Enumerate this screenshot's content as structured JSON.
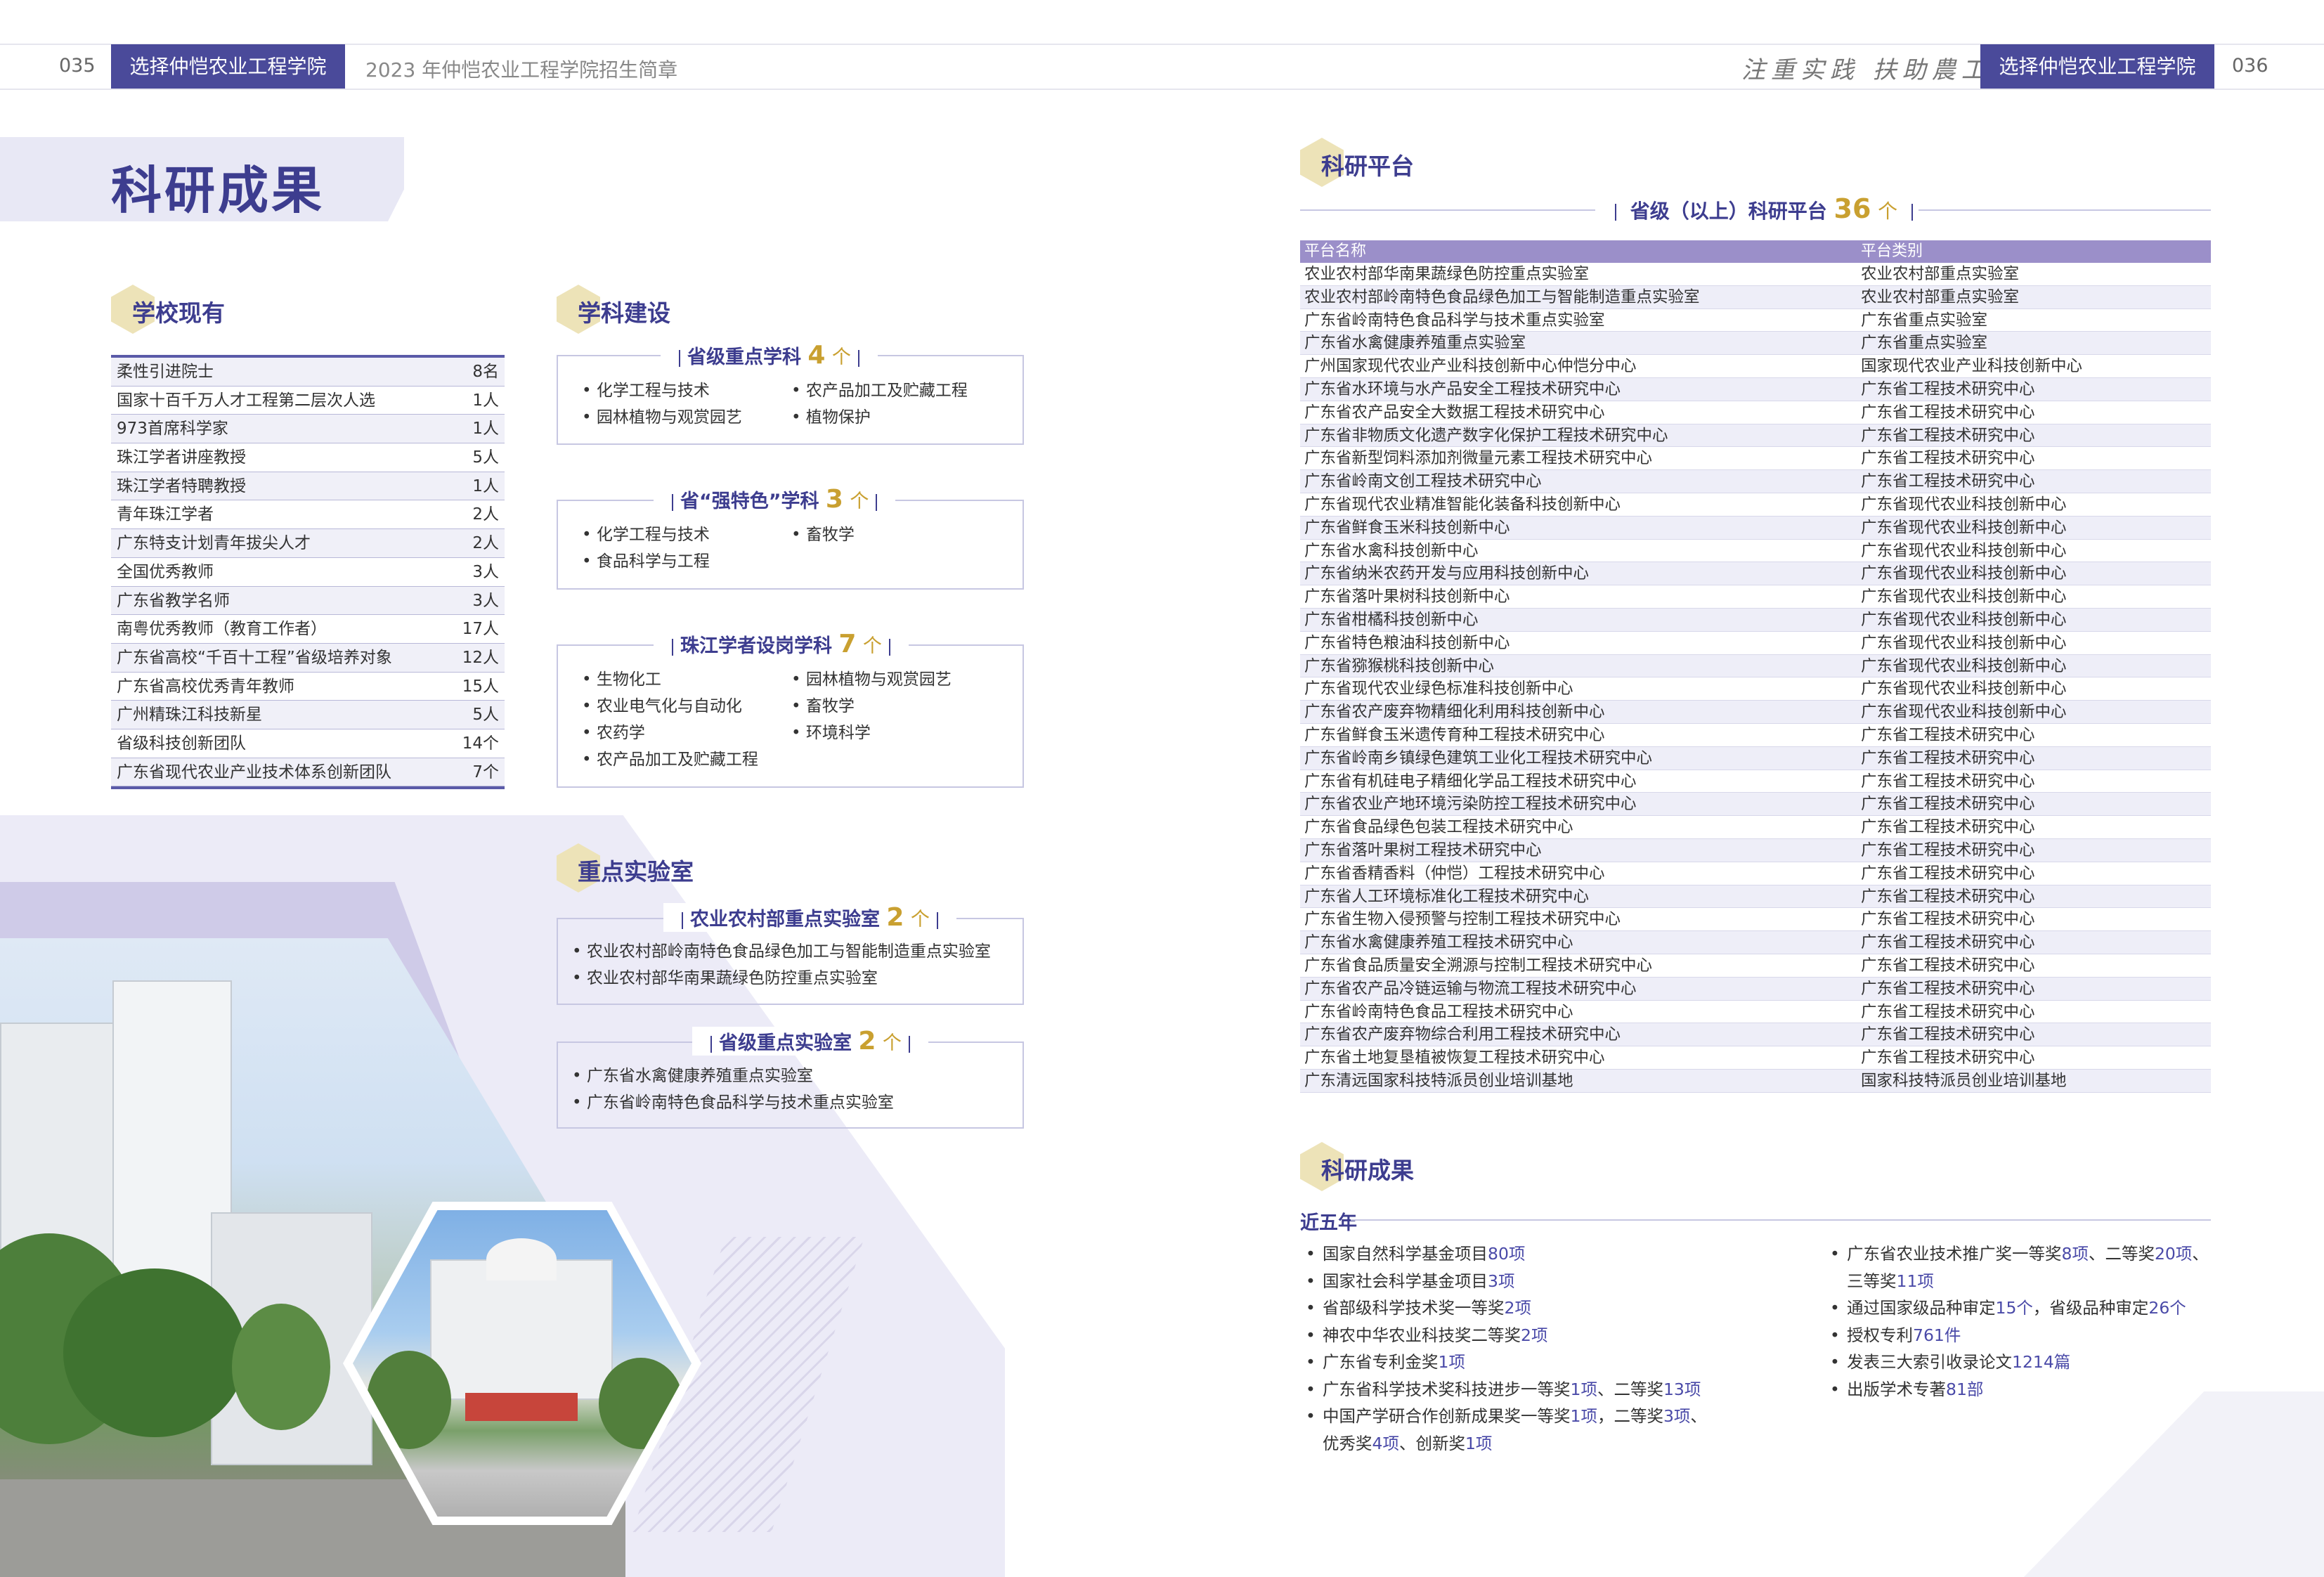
{
  "header": {
    "left_page_num": "035",
    "left_tab": "选择仲恺农业工程学院",
    "brochure_title": "2023 年仲恺农业工程学院招生简章",
    "slogan": "注重实践 扶助農工",
    "right_tab": "选择仲恺农业工程学院",
    "right_page_num": "036"
  },
  "page_title": "科研成果",
  "school": {
    "heading": "学校现有",
    "rows": [
      {
        "name": "柔性引进院士",
        "value": "8名"
      },
      {
        "name": "国家十百千万人才工程第二层次人选",
        "value": "1人"
      },
      {
        "name": "973首席科学家",
        "value": "1人"
      },
      {
        "name": "珠江学者讲座教授",
        "value": "5人"
      },
      {
        "name": "珠江学者特聘教授",
        "value": "1人"
      },
      {
        "name": "青年珠江学者",
        "value": "2人"
      },
      {
        "name": "广东特支计划青年拔尖人才",
        "value": "2人"
      },
      {
        "name": "全国优秀教师",
        "value": "3人"
      },
      {
        "name": "广东省教学名师",
        "value": "3人"
      },
      {
        "name": "南粤优秀教师（教育工作者）",
        "value": "17人"
      },
      {
        "name": "广东省高校“千百十工程”省级培养对象",
        "value": "12人"
      },
      {
        "name": "广东省高校优秀青年教师",
        "value": "15人"
      },
      {
        "name": "广州精珠江科技新星",
        "value": "5人"
      },
      {
        "name": "省级科技创新团队",
        "value": "14个"
      },
      {
        "name": "广东省现代农业产业技术体系创新团队",
        "value": "7个"
      }
    ]
  },
  "discipline": {
    "heading": "学科建设",
    "provincial_key": {
      "label": "省级重点学科",
      "count": "4",
      "unit": "个",
      "left": [
        "化学工程与技术",
        "园林植物与观赏园艺"
      ],
      "right": [
        "农产品加工及贮藏工程",
        "植物保护"
      ]
    },
    "strong": {
      "label": "省“强特色”学科",
      "count": "3",
      "unit": "个",
      "left": [
        "化学工程与技术",
        "食品科学与工程"
      ],
      "right": [
        "畜牧学"
      ]
    },
    "pearl": {
      "label": "珠江学者设岗学科",
      "count": "7",
      "unit": "个",
      "left": [
        "生物化工",
        "农业电气化与自动化",
        "农药学",
        "农产品加工及贮藏工程"
      ],
      "right": [
        "园林植物与观赏园艺",
        "畜牧学",
        "环境科学"
      ]
    }
  },
  "labs": {
    "heading": "重点实验室",
    "ministry": {
      "label": "农业农村部重点实验室",
      "count": "2",
      "unit": "个",
      "items": [
        "农业农村部岭南特色食品绿色加工与智能制造重点实验室",
        "农业农村部华南果蔬绿色防控重点实验室"
      ]
    },
    "provincial": {
      "label": "省级重点实验室",
      "count": "2",
      "unit": "个",
      "items": [
        "广东省水禽健康养殖重点实验室",
        "广东省岭南特色食品科学与技术重点实验室"
      ]
    }
  },
  "platform": {
    "heading": "科研平台",
    "title_label": "省级（以上）科研平台",
    "title_count": "36",
    "title_unit": "个",
    "col1": "平台名称",
    "col2": "平台类别",
    "rows": [
      [
        "农业农村部华南果蔬绿色防控重点实验室",
        "农业农村部重点实验室"
      ],
      [
        "农业农村部岭南特色食品绿色加工与智能制造重点实验室",
        "农业农村部重点实验室"
      ],
      [
        "广东省岭南特色食品科学与技术重点实验室",
        "广东省重点实验室"
      ],
      [
        "广东省水禽健康养殖重点实验室",
        "广东省重点实验室"
      ],
      [
        "广州国家现代农业产业科技创新中心仲恺分中心",
        "国家现代农业产业科技创新中心"
      ],
      [
        "广东省水环境与水产品安全工程技术研究中心",
        "广东省工程技术研究中心"
      ],
      [
        "广东省农产品安全大数据工程技术研究中心",
        "广东省工程技术研究中心"
      ],
      [
        "广东省非物质文化遗产数字化保护工程技术研究中心",
        "广东省工程技术研究中心"
      ],
      [
        "广东省新型饲料添加剂微量元素工程技术研究中心",
        "广东省工程技术研究中心"
      ],
      [
        "广东省岭南文创工程技术研究中心",
        "广东省工程技术研究中心"
      ],
      [
        "广东省现代农业精准智能化装备科技创新中心",
        "广东省现代农业科技创新中心"
      ],
      [
        "广东省鲜食玉米科技创新中心",
        "广东省现代农业科技创新中心"
      ],
      [
        "广东省水禽科技创新中心",
        "广东省现代农业科技创新中心"
      ],
      [
        "广东省纳米农药开发与应用科技创新中心",
        "广东省现代农业科技创新中心"
      ],
      [
        "广东省落叶果树科技创新中心",
        "广东省现代农业科技创新中心"
      ],
      [
        "广东省柑橘科技创新中心",
        "广东省现代农业科技创新中心"
      ],
      [
        "广东省特色粮油科技创新中心",
        "广东省现代农业科技创新中心"
      ],
      [
        "广东省猕猴桃科技创新中心",
        "广东省现代农业科技创新中心"
      ],
      [
        "广东省现代农业绿色标准科技创新中心",
        "广东省现代农业科技创新中心"
      ],
      [
        "广东省农产废弃物精细化利用科技创新中心",
        "广东省现代农业科技创新中心"
      ],
      [
        "广东省鲜食玉米遗传育种工程技术研究中心",
        "广东省工程技术研究中心"
      ],
      [
        "广东省岭南乡镇绿色建筑工业化工程技术研究中心",
        "广东省工程技术研究中心"
      ],
      [
        "广东省有机硅电子精细化学品工程技术研究中心",
        "广东省工程技术研究中心"
      ],
      [
        "广东省农业产地环境污染防控工程技术研究中心",
        "广东省工程技术研究中心"
      ],
      [
        "广东省食品绿色包装工程技术研究中心",
        "广东省工程技术研究中心"
      ],
      [
        "广东省落叶果树工程技术研究中心",
        "广东省工程技术研究中心"
      ],
      [
        "广东省香精香料（仲恺）工程技术研究中心",
        "广东省工程技术研究中心"
      ],
      [
        "广东省人工环境标准化工程技术研究中心",
        "广东省工程技术研究中心"
      ],
      [
        "广东省生物入侵预警与控制工程技术研究中心",
        "广东省工程技术研究中心"
      ],
      [
        "广东省水禽健康养殖工程技术研究中心",
        "广东省工程技术研究中心"
      ],
      [
        "广东省食品质量安全溯源与控制工程技术研究中心",
        "广东省工程技术研究中心"
      ],
      [
        "广东省农产品冷链运输与物流工程技术研究中心",
        "广东省工程技术研究中心"
      ],
      [
        "广东省岭南特色食品工程技术研究中心",
        "广东省工程技术研究中心"
      ],
      [
        "广东省农产废弃物综合利用工程技术研究中心",
        "广东省工程技术研究中心"
      ],
      [
        "广东省土地复垦植被恢复工程技术研究中心",
        "广东省工程技术研究中心"
      ],
      [
        "广东清远国家科技特派员创业培训基地",
        "国家科技特派员创业培训基地"
      ]
    ]
  },
  "results": {
    "heading": "科研成果",
    "sub": "近五年",
    "left": [
      [
        {
          "t": "国家自然科学基金项目"
        },
        {
          "n": "80项"
        }
      ],
      [
        {
          "t": "国家社会科学基金项目"
        },
        {
          "n": "3项"
        }
      ],
      [
        {
          "t": "省部级科学技术奖一等奖"
        },
        {
          "n": "2项"
        }
      ],
      [
        {
          "t": "神农中华农业科技奖二等奖"
        },
        {
          "n": "2项"
        }
      ],
      [
        {
          "t": "广东省专利金奖"
        },
        {
          "n": "1项"
        }
      ],
      [
        {
          "t": "广东省科学技术奖科技进步一等奖"
        },
        {
          "n": "1项"
        },
        {
          "t": "、二等奖"
        },
        {
          "n": "13项"
        }
      ],
      [
        {
          "t": "中国产学研合作创新成果奖一等奖"
        },
        {
          "n": "1项"
        },
        {
          "t": "，二等奖"
        },
        {
          "n": "3项"
        },
        {
          "t": "、"
        }
      ],
      [
        {
          "t": "优秀奖"
        },
        {
          "n": "4项"
        },
        {
          "t": "、创新奖"
        },
        {
          "n": "1项"
        }
      ]
    ],
    "right": [
      [
        {
          "t": "广东省农业技术推广奖一等奖"
        },
        {
          "n": "8项"
        },
        {
          "t": "、二等奖"
        },
        {
          "n": "20项"
        },
        {
          "t": "、"
        }
      ],
      [
        {
          "t": "三等奖"
        },
        {
          "n": "11项"
        }
      ],
      [
        {
          "t": "通过国家级品种审定"
        },
        {
          "n": "15个"
        },
        {
          "t": "，省级品种审定"
        },
        {
          "n": "26个"
        }
      ],
      [
        {
          "t": "授权专利"
        },
        {
          "n": "761件"
        }
      ],
      [
        {
          "t": "发表三大索引收录论文"
        },
        {
          "n": "1214篇"
        }
      ],
      [
        {
          "t": "出版学术专著"
        },
        {
          "n": "81部"
        }
      ]
    ]
  }
}
